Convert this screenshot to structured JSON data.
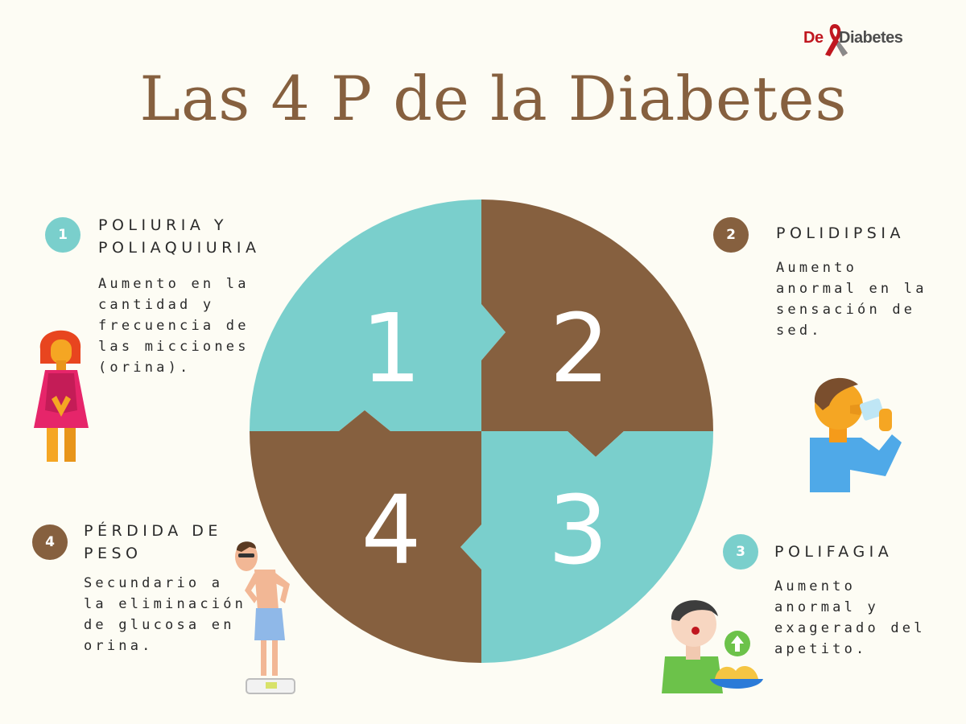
{
  "logo": {
    "prefix": "De",
    "name": "Diabetes"
  },
  "title": "Las 4 P de la Diabetes",
  "wheel": {
    "colors": {
      "teal": "#7acfcc",
      "brown": "#86603f"
    },
    "numbers": [
      "1",
      "2",
      "3",
      "4"
    ]
  },
  "items": [
    {
      "number": "1",
      "heading": "POLIURIA Y\nPOLIAQUIURIA",
      "description": "Aumento en la\ncantidad y\nfrecuencia de\nlas micciones\n(orina).",
      "color": "#7acfcc",
      "icon": "woman-urgency-illustration"
    },
    {
      "number": "2",
      "heading": "POLIDIPSIA",
      "description": "Aumento\nanormal en la\nsensación de\nsed.",
      "color": "#86603f",
      "icon": "man-drinking-water-illustration"
    },
    {
      "number": "3",
      "heading": "POLIFAGIA",
      "description": "Aumento\nanormal y\nexagerado del\napetito.",
      "color": "#7acfcc",
      "icon": "hungry-boy-illustration"
    },
    {
      "number": "4",
      "heading": "PÉRDIDA DE\nPESO",
      "description": "Secundario a\nla eliminación\nde glucosa en\norina.",
      "color": "#86603f",
      "icon": "thin-man-on-scale-illustration"
    }
  ]
}
